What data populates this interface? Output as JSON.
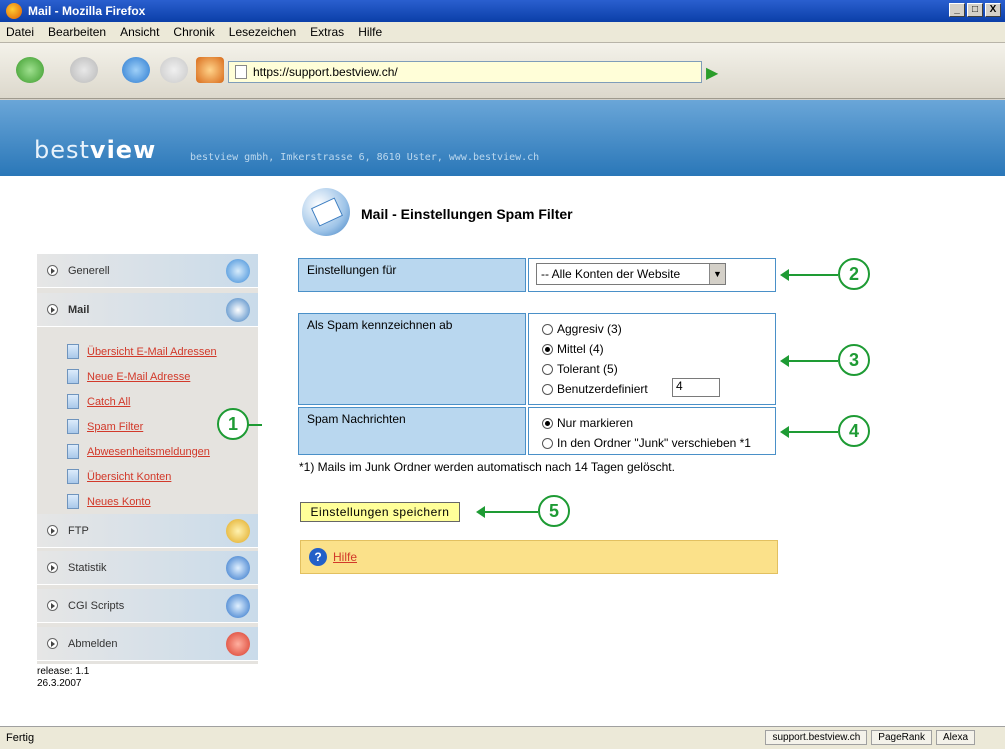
{
  "window": {
    "title": "Mail - Mozilla Firefox",
    "buttons": [
      "_",
      "□",
      "X"
    ]
  },
  "menu": {
    "items": [
      "Datei",
      "Bearbeiten",
      "Ansicht",
      "Chronik",
      "Lesezeichen",
      "Extras",
      "Hilfe"
    ]
  },
  "nav": {
    "url": "https://support.bestview.ch/"
  },
  "site": {
    "logo_light": "best",
    "logo_bold": "view",
    "tagline": "bestview gmbh, Imkerstrasse 6, 8610 Uster, www.bestview.ch"
  },
  "sidebar": {
    "sections": [
      "Generell",
      "Mail",
      "FTP",
      "Statistik",
      "CGI Scripts",
      "Abmelden"
    ],
    "mail_items": [
      "Übersicht E-Mail Adressen",
      "Neue E-Mail Adresse",
      "Catch All",
      "Spam Filter",
      "Abwesenheitsmeldungen",
      "Übersicht Konten",
      "Neues Konto"
    ],
    "release": "release: 1.1",
    "release_date": "26.3.2007"
  },
  "page": {
    "title": "Mail - Einstellungen Spam Filter",
    "settings_for_label": "Einstellungen für",
    "settings_for_value": "-- Alle Konten der Website",
    "spam_label": "Als Spam kennzeichnen ab",
    "spam_options": [
      "Aggresiv (3)",
      "Mittel (4)",
      "Tolerant (5)",
      "Benutzerdefiniert"
    ],
    "spam_selected": "Mittel (4)",
    "custom_value": "4",
    "messages_label": "Spam Nachrichten",
    "messages_options": [
      "Nur markieren",
      "In den Ordner \"Junk\" verschieben *1"
    ],
    "messages_selected": "Nur markieren",
    "note": "*1) Mails im Junk Ordner werden automatisch nach 14 Tagen gelöscht.",
    "save": "Einstellungen speichern",
    "help": "Hilfe"
  },
  "callouts": [
    "1",
    "2",
    "3",
    "4",
    "5"
  ],
  "status": {
    "text": "Fertig",
    "domain": "support.bestview.ch",
    "pagerank": "PageRank",
    "alexa": "Alexa"
  },
  "colors": {
    "accent_green": "#1e9b34",
    "header_blue": "#2a77b8",
    "link_red": "#d2392a"
  }
}
